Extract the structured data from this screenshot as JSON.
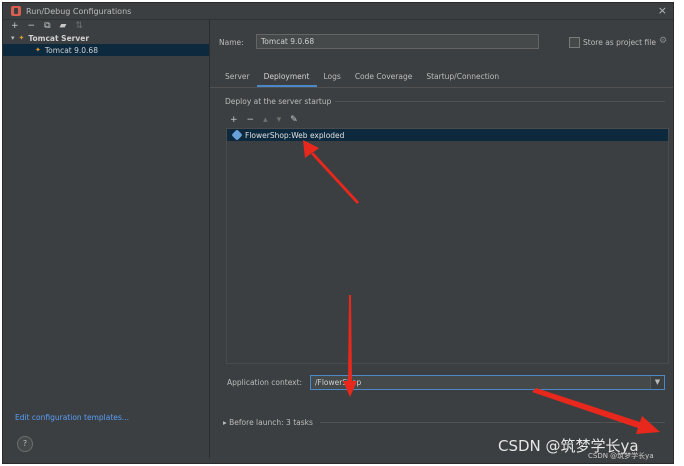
{
  "window": {
    "title": "Run/Debug Configurations"
  },
  "left_toolbar": {
    "icons": [
      "add-icon",
      "remove-icon",
      "copy-icon",
      "folder-icon",
      "sort-icon"
    ]
  },
  "tree": {
    "parent": "Tomcat Server",
    "child": "Tomcat 9.0.68"
  },
  "left_footer": {
    "edit_templates": "Edit configuration templates...",
    "help": "?"
  },
  "name_row": {
    "label": "Name:",
    "value": "Tomcat 9.0.68",
    "store_label": "Store as project file"
  },
  "tabs": [
    "Server",
    "Deployment",
    "Logs",
    "Code Coverage",
    "Startup/Connection"
  ],
  "deploy": {
    "section_title": "Deploy at the server startup",
    "items": [
      "FlowerShop:Web exploded"
    ]
  },
  "context": {
    "label": "Application context:",
    "value": "/FlowerShop"
  },
  "before_launch": "Before launch: 3 tasks",
  "watermark": {
    "main": "CSDN @筑梦学长ya",
    "small": "CSDN @筑梦学长ya"
  },
  "colors": {
    "accent": "#4a88c7",
    "selection": "#0d293e",
    "arrow": "#e8281c"
  }
}
